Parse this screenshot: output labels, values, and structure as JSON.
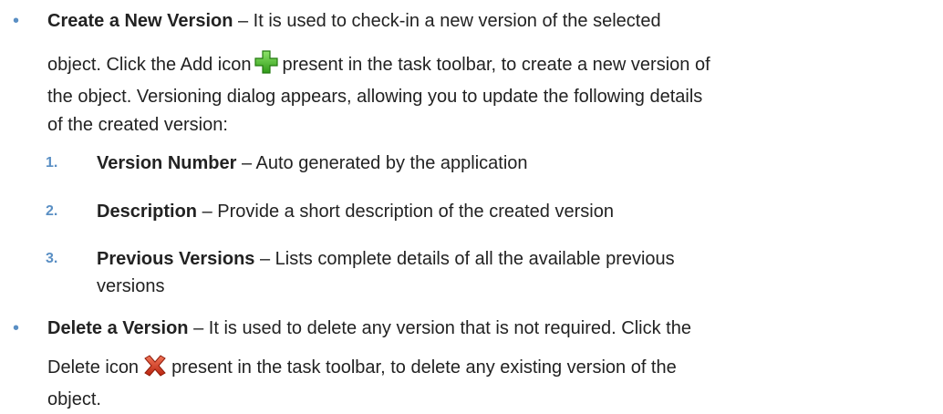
{
  "bullets": [
    {
      "title": "Create a New Version",
      "text_1": " – It is used to check-in a new version of the selected",
      "text_2a": "object. Click the Add icon",
      "text_2b": "present in the task toolbar, to create a new version of",
      "text_3": "the object. Versioning dialog appears, allowing you to update the following details",
      "text_4": "of the created version:",
      "icon": "add-plus-icon"
    },
    {
      "title": "Delete a Version",
      "text_1": " – It is used to delete any version that is not required. Click the",
      "text_2a": "Delete icon",
      "text_2b": "present in the task toolbar, to delete any existing version of the",
      "text_3": "object.",
      "icon": "delete-x-icon"
    }
  ],
  "steps": [
    {
      "marker": "1.",
      "title": "Version Number",
      "text": " – Auto generated by the application"
    },
    {
      "marker": "2.",
      "title": "Description",
      "text": " – Provide a short description of the created version"
    },
    {
      "marker": "3.",
      "title": "Previous Versions",
      "text": " – Lists complete details of all the available previous",
      "text_2": "versions"
    }
  ],
  "colors": {
    "marker": "#5a8fc4",
    "text": "#222222",
    "add_icon": "#3cb01e",
    "delete_icon": "#d6381c"
  },
  "bullet_glyph": "•"
}
